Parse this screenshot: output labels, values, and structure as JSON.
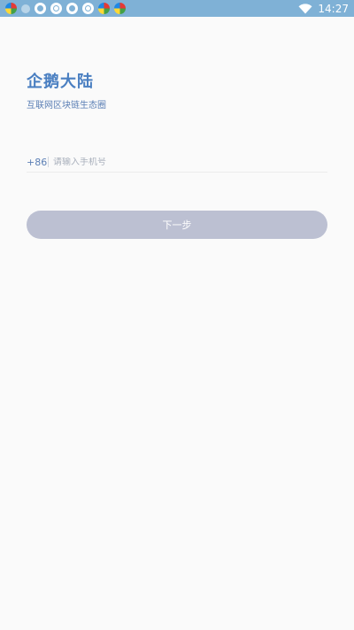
{
  "status_bar": {
    "time": "14:27",
    "notification_icons": [
      "multicolor-app-icon",
      "faded-icon",
      "chat-bubble-icon",
      "ring-icon",
      "chat-bubble-icon",
      "ring-icon",
      "multicolor-app-icon",
      "multicolor-app-icon"
    ],
    "wifi_icon": "wifi-icon",
    "background_color": "#7fb1d6"
  },
  "header": {
    "title": "企鹅大陆",
    "subtitle": "互联网区块链生态圈"
  },
  "phone_form": {
    "country_code": "+86",
    "placeholder": "请输入手机号",
    "value": ""
  },
  "next_button": {
    "label": "下一步",
    "color": "#bcc0d2"
  },
  "colors": {
    "accent": "#4a7fc1",
    "background": "#fafafa"
  }
}
